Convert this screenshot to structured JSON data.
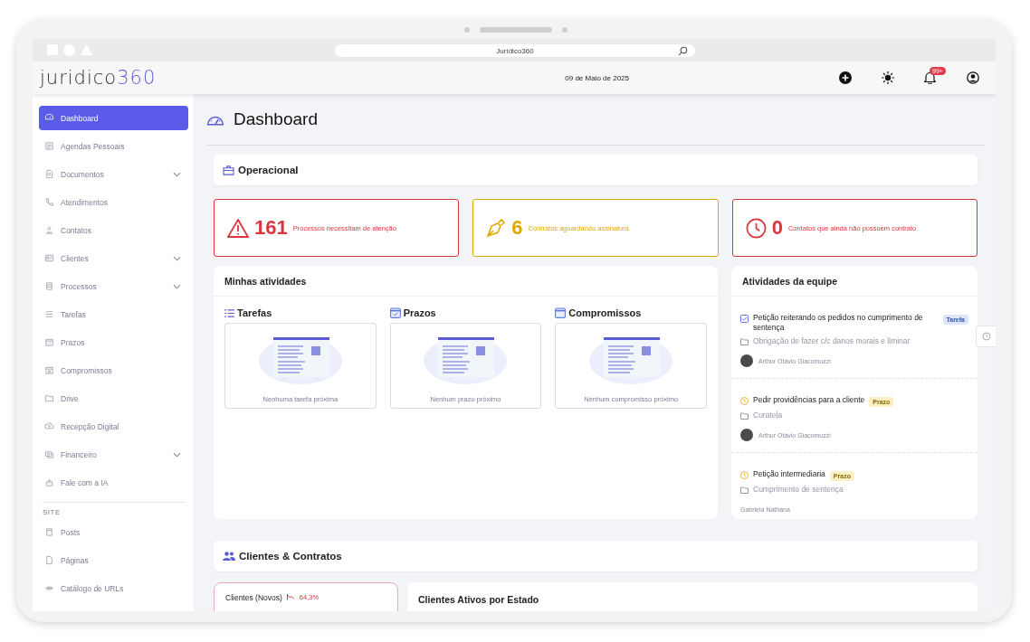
{
  "browser": {
    "url": "Jurídico360"
  },
  "header": {
    "logo_text": "juridico",
    "logo_number": "360",
    "date": "09 de Maio de 2025",
    "notification_count": "99+"
  },
  "sidebar": {
    "items": [
      {
        "label": "Dashboard",
        "selected": true,
        "submenu": false
      },
      {
        "label": "Agendas Pessoais",
        "selected": false,
        "submenu": false
      },
      {
        "label": "Documentos",
        "selected": false,
        "submenu": true
      },
      {
        "label": "Atendimentos",
        "selected": false,
        "submenu": false
      },
      {
        "label": "Contatos",
        "selected": false,
        "submenu": false
      },
      {
        "label": "Clientes",
        "selected": false,
        "submenu": true
      },
      {
        "label": "Processos",
        "selected": false,
        "submenu": true
      },
      {
        "label": "Tarefas",
        "selected": false,
        "submenu": false
      },
      {
        "label": "Prazos",
        "selected": false,
        "submenu": false
      },
      {
        "label": "Compromissos",
        "selected": false,
        "submenu": false
      },
      {
        "label": "Drive",
        "selected": false,
        "submenu": false
      },
      {
        "label": "Recepção Digital",
        "selected": false,
        "submenu": false
      },
      {
        "label": "Financeiro",
        "selected": false,
        "submenu": true
      },
      {
        "label": "Fale com a IA",
        "selected": false,
        "submenu": false
      }
    ],
    "section_title": "SITE",
    "site_items": [
      {
        "label": "Posts",
        "selected": false
      },
      {
        "label": "Páginas",
        "selected": false
      },
      {
        "label": "Catálogo de URLs",
        "selected": false
      }
    ]
  },
  "page_title": "Dashboard",
  "operacional": {
    "title": "Operacional",
    "alerts": [
      {
        "count": "161",
        "text": "Processos necessitam de atenção",
        "color": "#d9363e"
      },
      {
        "count": "6",
        "text": "Contratos aguardando assinatura",
        "color": "#e0a800"
      },
      {
        "count": "0",
        "text": "Contatos que ainda não possuem contrato",
        "color": "#d9363e"
      }
    ]
  },
  "minhas_atividades": {
    "title": "Minhas atividades",
    "columns": [
      {
        "title": "Tarefas",
        "empty_text": "Nenhuma tarefa próxima"
      },
      {
        "title": "Prazos",
        "empty_text": "Nenhum prazo próximo"
      },
      {
        "title": "Compromissos",
        "empty_text": "Nenhum compromisso próximo"
      }
    ]
  },
  "atividades_equipe": {
    "title": "Atividades da equipe",
    "items": [
      {
        "kind": "tarefa",
        "title": "Petição reiterando os pedidos no cumprimento de sentença",
        "tag": "Tarefa",
        "case": "Obrigação de fazer c/c danos morais e liminar",
        "person": "Arthur Otávio Giacomuzzi",
        "avatar": true
      },
      {
        "kind": "prazo",
        "title": "Pedir providências para a cliente",
        "tag": "Prazo",
        "case": "Curatela",
        "person": "Arthur Otávio Giacomuzzi",
        "avatar": true
      },
      {
        "kind": "prazo",
        "title": "Petição intermediaria",
        "tag": "Prazo",
        "case": "Cumprimento de sentença",
        "person": "Gabriela Nathana",
        "avatar": false
      }
    ]
  },
  "clientes_contratos": {
    "title": "Clientes & Contratos",
    "new_clients": {
      "title": "Clientes (Novos)",
      "change": "64,3%"
    },
    "active_by_state": {
      "title": "Clientes Ativos por Estado"
    }
  }
}
